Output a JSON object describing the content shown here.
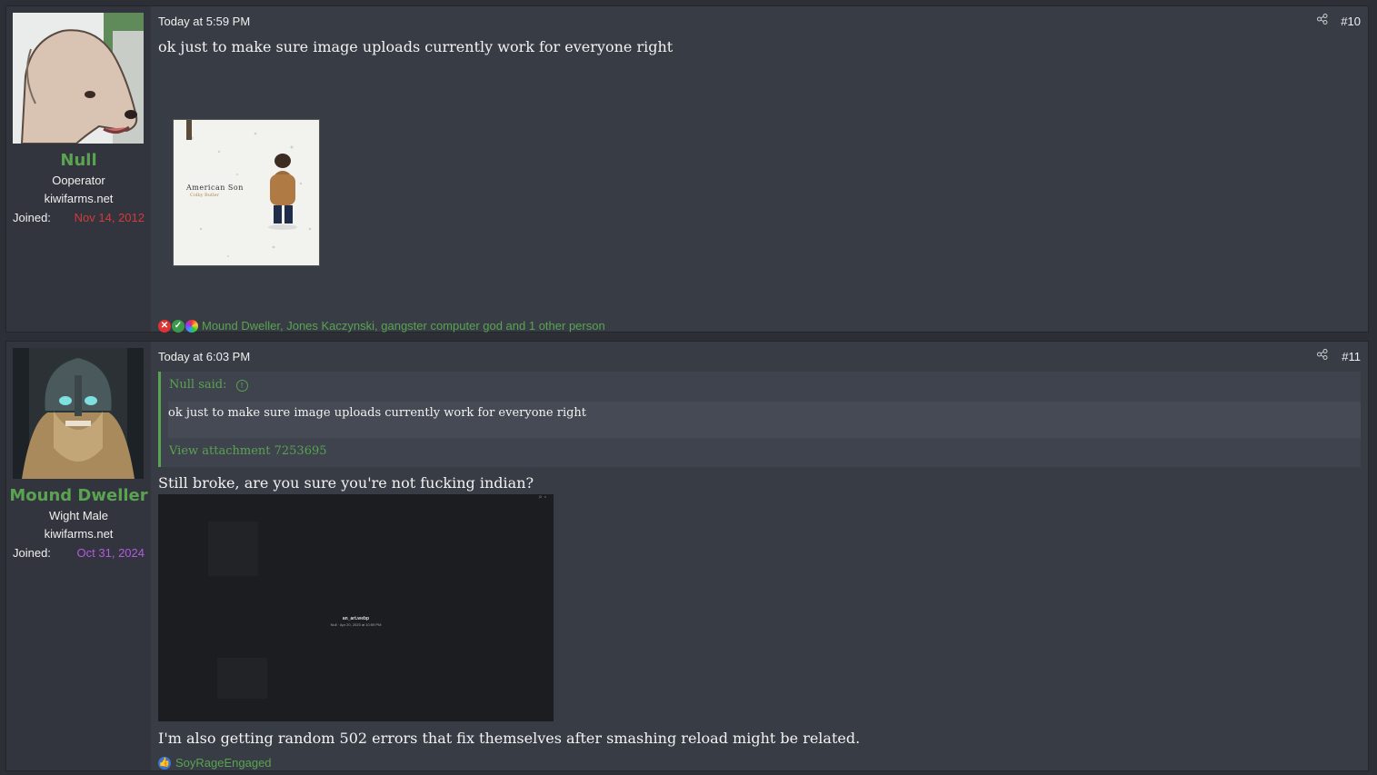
{
  "posts": [
    {
      "user": {
        "name": "Null",
        "title": "Ooperator",
        "site": "kiwifarms.net",
        "joined_label": "Joined:",
        "joined_date": "Nov 14, 2012",
        "joined_color": "#d23b3b"
      },
      "time": "Today at 5:59 PM",
      "share_icon": "share-icon",
      "number": "#10",
      "text": "ok just to make sure image uploads currently work for everyone right",
      "attachment": {
        "title": "American Son",
        "subtitle": "Colby Butler"
      },
      "reactions": {
        "icons": [
          "x-icon",
          "check-icon",
          "rainbow-icon"
        ],
        "text": "Mound Dweller, Jones Kaczynski, gangster computer god and 1 other person"
      }
    },
    {
      "user": {
        "name": "Mound Dweller",
        "title": "Wight Male",
        "site": "kiwifarms.net",
        "joined_label": "Joined:",
        "joined_date": "Oct 31, 2024",
        "joined_color": "#b25be0"
      },
      "time": "Today at 6:03 PM",
      "share_icon": "share-icon",
      "number": "#11",
      "quote": {
        "author": "Null said:",
        "text": "ok just to make sure image uploads currently work for everyone right",
        "link": "View attachment 7253695"
      },
      "text1": "Still broke, are you sure you're not fucking indian?",
      "screenshot": {
        "filename": "an_art.webp",
        "meta": "Null · Apr 20, 2025 at 10:59 PM"
      },
      "text2": "I'm also getting random 502 errors that fix themselves after smashing reload might be related.",
      "reactions": {
        "icons": [
          "thumbs-up-icon"
        ],
        "text": "SoyRageEngaged"
      }
    }
  ]
}
